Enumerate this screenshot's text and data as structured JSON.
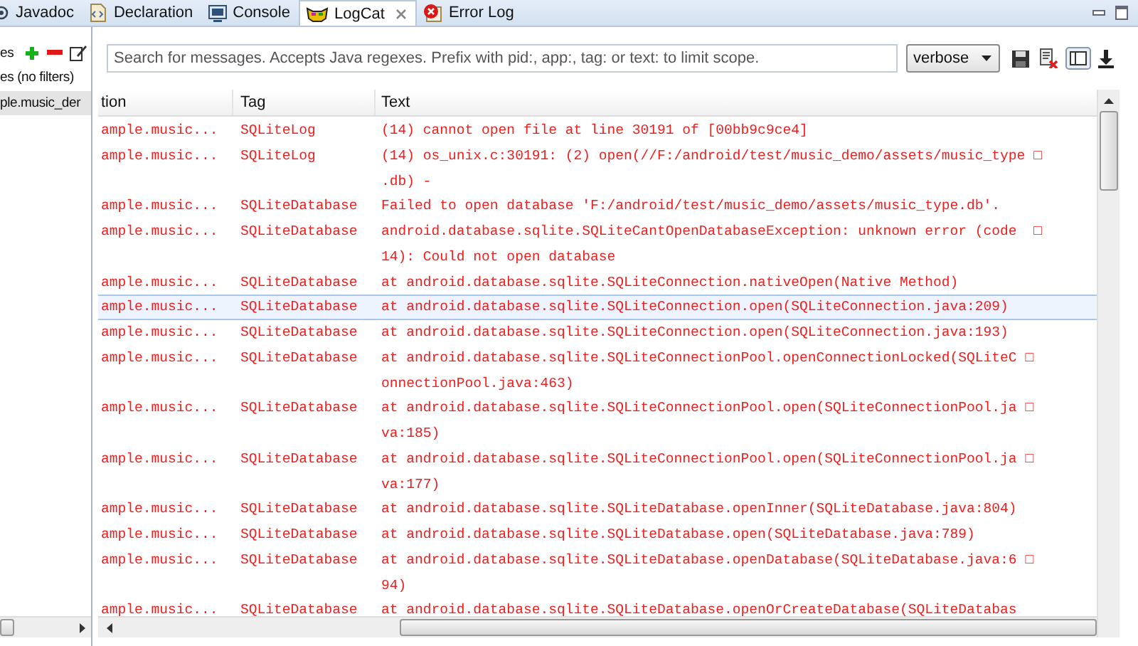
{
  "tabs": [
    {
      "label": "Javadoc",
      "kind": "javadoc",
      "selected": false
    },
    {
      "label": "Declaration",
      "kind": "declaration",
      "selected": false
    },
    {
      "label": "Console",
      "kind": "console",
      "selected": false
    },
    {
      "label": "LogCat",
      "kind": "logcat",
      "selected": true
    },
    {
      "label": "Error Log",
      "kind": "errorlog",
      "selected": false
    }
  ],
  "filters": {
    "header": "es",
    "items": [
      {
        "label": "es (no filters)",
        "selected": false
      },
      {
        "label": "ple.music_der",
        "selected": true
      }
    ]
  },
  "toolbar": {
    "search_placeholder": "Search for messages. Accepts Java regexes. Prefix with pid:, app:, tag: or text: to limit scope.",
    "level": "verbose"
  },
  "log": {
    "columns": [
      "tion",
      "Tag",
      "Text"
    ],
    "rows": [
      {
        "app": "ample.music...",
        "tag": "SQLiteLog",
        "lines": [
          "(14) cannot open file at line 30191 of [00bb9c9ce4]"
        ],
        "selected": false
      },
      {
        "app": "ample.music...",
        "tag": "SQLiteLog",
        "lines": [
          "(14) os_unix.c:30191: (2) open(//F:/android/test/music_demo/assets/music_type □",
          ".db) -"
        ],
        "selected": false
      },
      {
        "app": "ample.music...",
        "tag": "SQLiteDatabase",
        "lines": [
          "Failed to open database 'F:/android/test/music_demo/assets/music_type.db'."
        ],
        "selected": false
      },
      {
        "app": "ample.music...",
        "tag": "SQLiteDatabase",
        "lines": [
          "android.database.sqlite.SQLiteCantOpenDatabaseException: unknown error (code  □",
          "14): Could not open database"
        ],
        "selected": false
      },
      {
        "app": "ample.music...",
        "tag": "SQLiteDatabase",
        "lines": [
          "at android.database.sqlite.SQLiteConnection.nativeOpen(Native Method)"
        ],
        "selected": false
      },
      {
        "app": "ample.music...",
        "tag": "SQLiteDatabase",
        "lines": [
          "at android.database.sqlite.SQLiteConnection.open(SQLiteConnection.java:209)"
        ],
        "selected": true
      },
      {
        "app": "ample.music...",
        "tag": "SQLiteDatabase",
        "lines": [
          "at android.database.sqlite.SQLiteConnection.open(SQLiteConnection.java:193)"
        ],
        "selected": false
      },
      {
        "app": "ample.music...",
        "tag": "SQLiteDatabase",
        "lines": [
          "at android.database.sqlite.SQLiteConnectionPool.openConnectionLocked(SQLiteC □",
          "onnectionPool.java:463)"
        ],
        "selected": false
      },
      {
        "app": "ample.music...",
        "tag": "SQLiteDatabase",
        "lines": [
          "at android.database.sqlite.SQLiteConnectionPool.open(SQLiteConnectionPool.ja □",
          "va:185)"
        ],
        "selected": false
      },
      {
        "app": "ample.music...",
        "tag": "SQLiteDatabase",
        "lines": [
          "at android.database.sqlite.SQLiteConnectionPool.open(SQLiteConnectionPool.ja □",
          "va:177)"
        ],
        "selected": false
      },
      {
        "app": "ample.music...",
        "tag": "SQLiteDatabase",
        "lines": [
          "at android.database.sqlite.SQLiteDatabase.openInner(SQLiteDatabase.java:804)"
        ],
        "selected": false
      },
      {
        "app": "ample.music...",
        "tag": "SQLiteDatabase",
        "lines": [
          "at android.database.sqlite.SQLiteDatabase.open(SQLiteDatabase.java:789)"
        ],
        "selected": false
      },
      {
        "app": "ample.music...",
        "tag": "SQLiteDatabase",
        "lines": [
          "at android.database.sqlite.SQLiteDatabase.openDatabase(SQLiteDatabase.java:6 □",
          "94)"
        ],
        "selected": false
      },
      {
        "app": "ample.music...",
        "tag": "SQLiteDatabase",
        "lines": [
          "at android.database.sqlite.SQLiteDatabase.openOrCreateDatabase(SQLiteDatabas"
        ],
        "selected": false
      }
    ]
  }
}
